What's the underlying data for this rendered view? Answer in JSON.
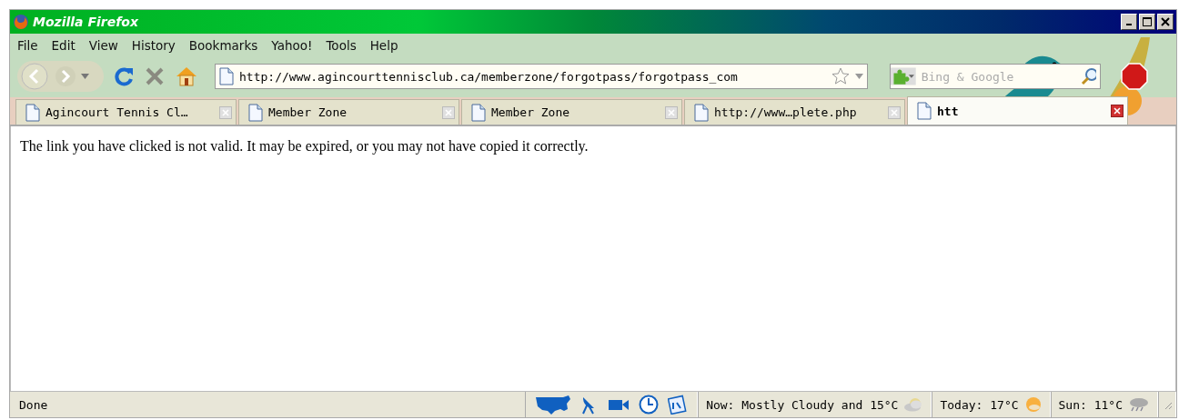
{
  "window": {
    "title": "Mozilla Firefox"
  },
  "menu": [
    {
      "label": "File"
    },
    {
      "label": "Edit"
    },
    {
      "label": "View"
    },
    {
      "label": "History"
    },
    {
      "label": "Bookmarks"
    },
    {
      "label": "Yahoo!"
    },
    {
      "label": "Tools"
    },
    {
      "label": "Help"
    }
  ],
  "address_bar": {
    "value": "http://www.agincourttennisclub.ca/memberzone/forgotpass/forgotpass_com"
  },
  "search": {
    "placeholder": "Bing & Google"
  },
  "tabs": [
    {
      "label": "Agincourt Tennis Cl…",
      "selected": false
    },
    {
      "label": "Member Zone",
      "selected": false
    },
    {
      "label": "Member Zone",
      "selected": false
    },
    {
      "label": "http://www…plete.php",
      "selected": false
    },
    {
      "label": "htt",
      "selected": true
    }
  ],
  "content": {
    "message": "The link you have clicked is not valid. It may be expired, or you may not have copied it correctly."
  },
  "status_bar": {
    "status": "Done",
    "weather": [
      {
        "text": "Now: Mostly Cloudy and 15°C",
        "kind": "cloudy"
      },
      {
        "text": "Today: 17°C",
        "kind": "sunny"
      },
      {
        "text": "Sun: 11°C",
        "kind": "rain"
      }
    ]
  }
}
